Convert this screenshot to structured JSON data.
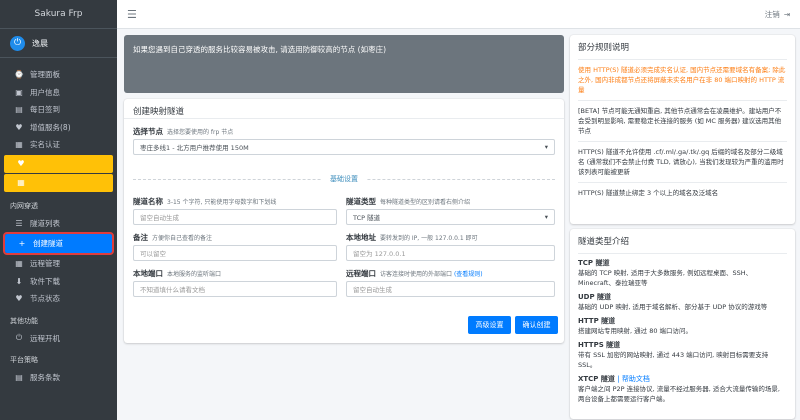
{
  "brand": "Sakura Frp",
  "user": {
    "name": "逸晨"
  },
  "nav": {
    "items_top": [
      {
        "icon": "⌚",
        "label": "管理面板"
      },
      {
        "icon": "▣",
        "label": "用户信息"
      },
      {
        "icon": "▤",
        "label": "每日签到"
      },
      {
        "icon": "♥",
        "label": "增值服务(8)"
      },
      {
        "icon": "▦",
        "label": "实名认证"
      }
    ],
    "warn_items": [
      {
        "label": "",
        "icon": "♥"
      },
      {
        "label": "",
        "icon": "▦"
      }
    ],
    "section_tunnel": "内网穿透",
    "items_tunnel": [
      {
        "icon": "☰",
        "label": "隧道列表"
      },
      {
        "icon": "+",
        "label": "创建隧道"
      },
      {
        "icon": "▦",
        "label": "远程管理"
      },
      {
        "icon": "⬇",
        "label": "软件下载"
      },
      {
        "icon": "♥",
        "label": "节点状态"
      }
    ],
    "section_other": "其他功能",
    "items_other": [
      {
        "icon": "⏻",
        "label": "远程开机"
      }
    ],
    "section_platform": "平台策略",
    "items_platform": [
      {
        "icon": "▤",
        "label": "服务条款"
      }
    ]
  },
  "topbar": {
    "logout": "注销"
  },
  "alert": {
    "big": "",
    "small": "如果您遇到自己穿透的服务比较容易被攻击, 请选用防御较高的节点 (如枣庄)"
  },
  "form": {
    "title": "创建映射隧道",
    "node_label": "选择节点",
    "node_hint": "选择您要使用的 frp 节点",
    "node_value": "枣庄多线1 - 北方用户推荐使用 150M",
    "basic_settings": "基础设置",
    "name_label": "隧道名称",
    "name_hint": "3-15 个字符, 只能使用字母数字和下划线",
    "name_placeholder": "留空自动生成",
    "type_label": "隧道类型",
    "type_hint": "每种隧道类型的区别请看右侧介绍",
    "type_value": "TCP 隧道",
    "note_label": "备注",
    "note_hint": "方便你自己查看的备注",
    "note_placeholder": "可以留空",
    "local_addr_label": "本地地址",
    "local_addr_hint": "要转发到的 IP, 一般 127.0.0.1 即可",
    "local_addr_placeholder": "留空为 127.0.0.1",
    "local_port_label": "本地端口",
    "local_port_hint": "本地服务的监听端口",
    "local_port_placeholder": "不知道填什么请看文档",
    "remote_port_label": "远程端口",
    "remote_port_hint": "访客连接时使用的外部端口",
    "remote_port_link": "(查看规则)",
    "remote_port_placeholder": "留空自动生成",
    "advanced_button": "高级设置",
    "confirm_button": "确认创建"
  },
  "rules": {
    "title": "部分规则说明",
    "items": [
      "使用 HTTP(S) 隧道必须完成实名认证, 国内节点还需要域名有备案; 除此之外, 国内非成都节点还将屏蔽未实名用户在非 80 端口映射的 HTTP 流量",
      "[BETA] 节点可能无通知重启, 其他节点通常会在凌晨维护。建站用户不会受到明显影响, 需要稳定长连接的服务 (如 MC 服务器) 建议选用其他节点",
      "HTTP(S) 隧道不允许使用 .cf/.ml/.ga/.tk/.gq 后缀的域名及部分二级域名 (通常我们不会禁止付费 TLD, 请放心), 当我们发现较为严重的滥用时该列表可能被更新",
      "HTTP(S) 隧道禁止绑定 3 个以上的域名及泛域名"
    ]
  },
  "types": {
    "title": "隧道类型介绍",
    "items": [
      {
        "name": "TCP 隧道",
        "desc": "基础的 TCP 映射, 适用于大多数服务, 例如远程桌面、SSH、Minecraft、泰拉瑞亚等"
      },
      {
        "name": "UDP 隧道",
        "desc": "基础的 UDP 映射, 适用于域名解析、部分基于 UDP 协议的游戏等"
      },
      {
        "name": "HTTP 隧道",
        "desc": "搭建网站专用映射, 通过 80 端口访问。"
      },
      {
        "name": "HTTPS 隧道",
        "desc": "带有 SSL 加密的网站映射, 通过 443 端口访问, 映射目标需要支持 SSL。"
      },
      {
        "name": "XTCP 隧道",
        "link": "| 帮助文档",
        "desc": "客户端之间 P2P 连接协议, 流量不经过服务器, 适合大流量传输的场景, 两台设备上都需要运行客户端。"
      }
    ]
  }
}
